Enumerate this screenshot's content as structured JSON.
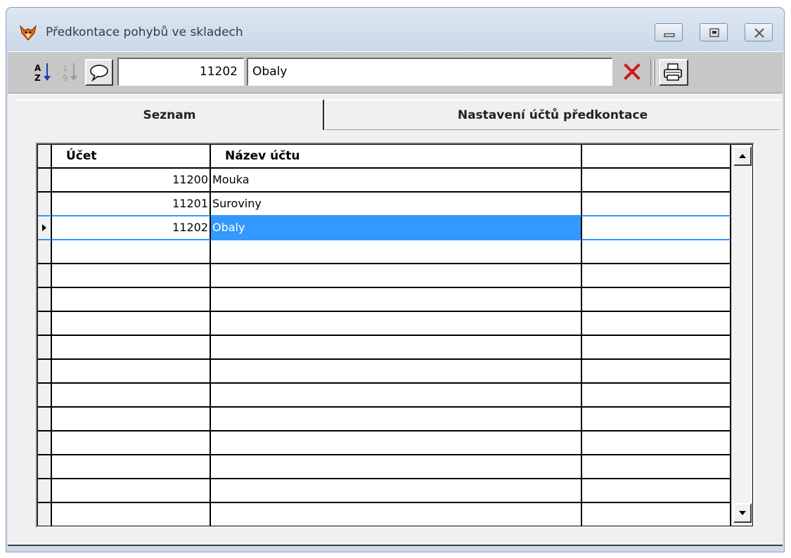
{
  "window": {
    "title": "Předkontace pohybů ve skladech",
    "app_icon": "fox-icon",
    "buttons": {
      "minimize": "minimize-icon",
      "restore": "restore-icon",
      "close": "close-icon"
    }
  },
  "toolbar": {
    "sort_az_icon": "sort-az-icon",
    "sort_19_icon": "sort-numeric-icon",
    "comment_icon": "speech-bubble-icon",
    "account_number": "11202",
    "account_name": "Obaly",
    "delete_icon": "delete-x-icon",
    "print_icon": "printer-icon",
    "colors": {
      "delete": "#d01818"
    }
  },
  "tabs": [
    {
      "label": "Seznam",
      "active": true
    },
    {
      "label": "Nastavení účtů předkontace",
      "active": false
    }
  ],
  "grid": {
    "columns": [
      "Účet",
      "Název účtu",
      ""
    ],
    "rows": [
      {
        "ucet": "11200",
        "nazev": "Mouka",
        "extra": ""
      },
      {
        "ucet": "11201",
        "nazev": "Suroviny",
        "extra": ""
      },
      {
        "ucet": "11202",
        "nazev": "Obaly",
        "extra": ""
      }
    ],
    "selected_row": 2,
    "selection_color": "#3399ff",
    "row_indicator_icon": "current-row-triangle-icon",
    "scroll_up_icon": "scroll-up-arrow-icon",
    "scroll_down_icon": "scroll-down-arrow-icon"
  }
}
